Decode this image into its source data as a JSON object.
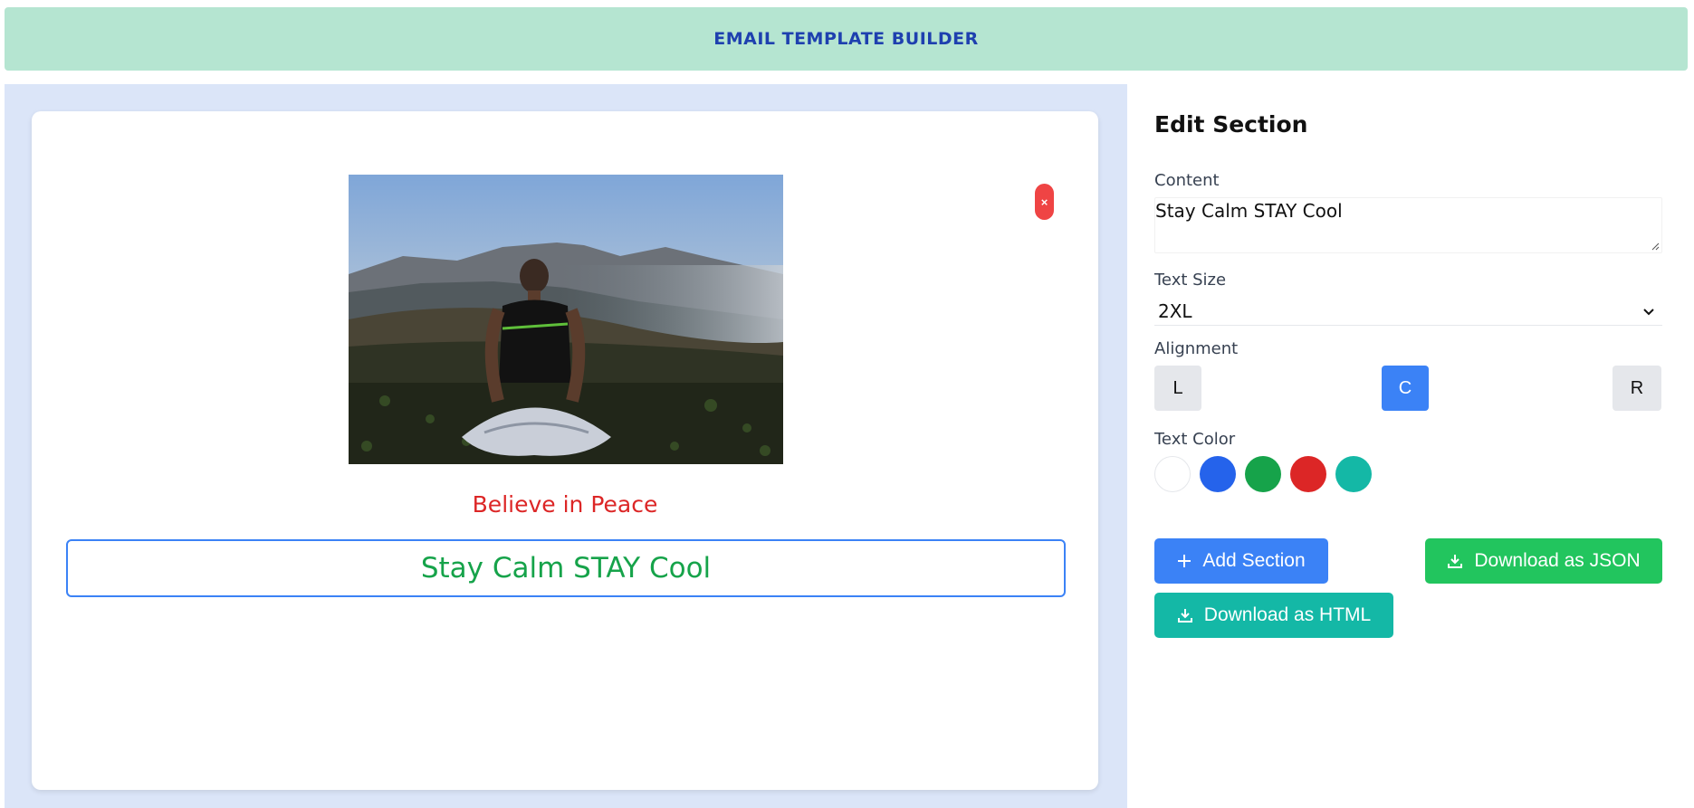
{
  "header": {
    "title": "EMAIL TEMPLATE BUILDER"
  },
  "email": {
    "delete_label": "×",
    "headline": "Believe in Peace",
    "selected_section_text": "Stay Calm STAY Cool"
  },
  "editor": {
    "title": "Edit Section",
    "content_label": "Content",
    "content_value": "Stay Calm STAY Cool",
    "text_size_label": "Text Size",
    "text_size_value": "2XL",
    "alignment_label": "Alignment",
    "alignment_options": [
      "L",
      "C",
      "R"
    ],
    "alignment_selected": "C",
    "text_color_label": "Text Color",
    "text_colors": [
      "#ffffff",
      "#2563eb",
      "#16a34a",
      "#dc2626",
      "#14b8a6"
    ],
    "buttons": {
      "add_section": "Add Section",
      "download_json": "Download as JSON",
      "download_html": "Download as HTML"
    }
  },
  "colors": {
    "header_bg": "#b5e5d1",
    "accent_blue": "#3b82f6",
    "green": "#22c55e",
    "teal": "#14b8a6",
    "danger": "#ef4444"
  }
}
